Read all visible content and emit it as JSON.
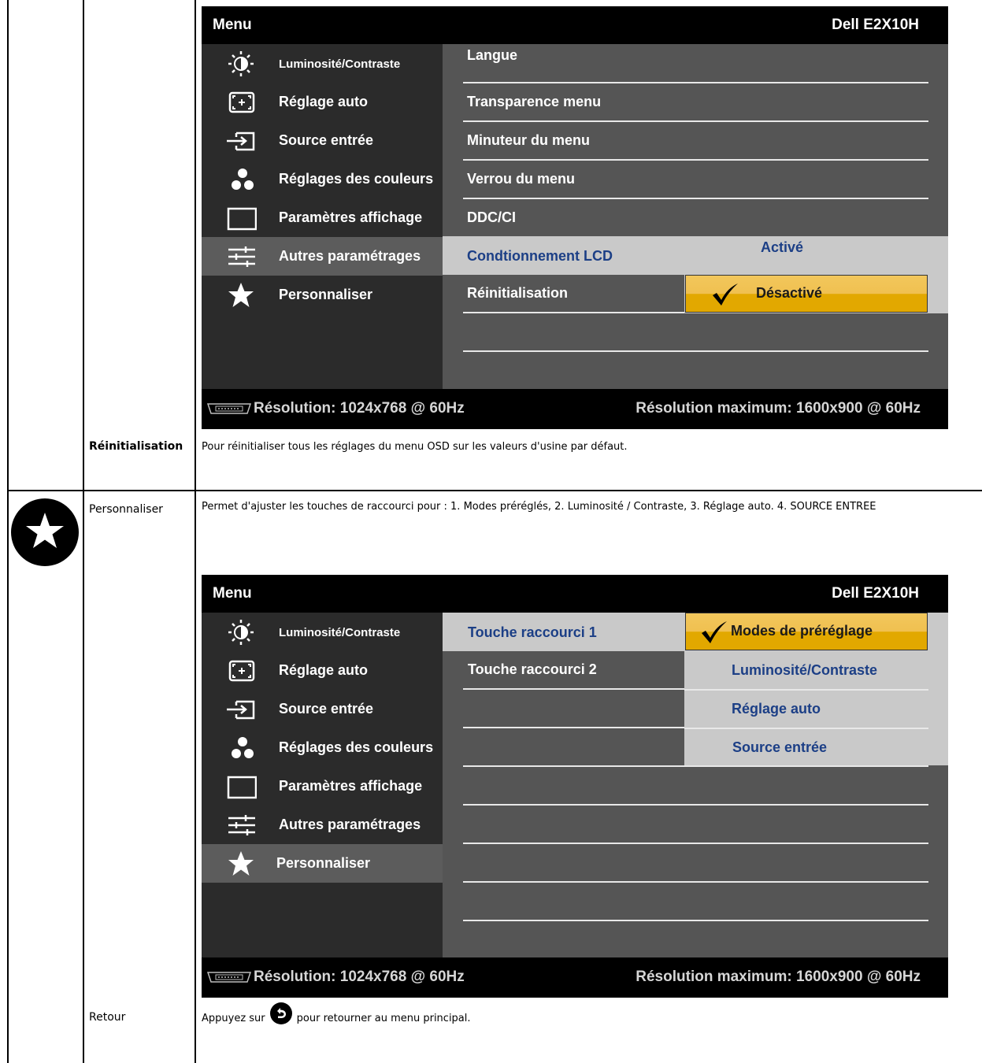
{
  "rows": {
    "reset": {
      "label": "Réinitialisation",
      "description": "Pour réinitialiser tous les réglages du menu OSD sur les valeurs d'usine par défaut."
    },
    "personalize": {
      "label": "Personnaliser",
      "description": "Permet d'ajuster les touches de raccourci pour : 1. Modes préréglés, 2. Luminosité / Contraste, 3. Réglage auto. 4. SOURCE ENTRÉE"
    },
    "back": {
      "label": "Retour",
      "description_before": "Appuyez sur",
      "description_after": "pour retourner au menu principal."
    }
  },
  "osd": {
    "title": "Menu",
    "model": "Dell E2X10H",
    "resolution": "Résolution: 1024x768 @ 60Hz",
    "max_resolution": "Résolution maximum: 1600x900 @ 60Hz",
    "menu_items": [
      {
        "label": "Luminosité/Contraste",
        "icon": "brightness-icon"
      },
      {
        "label": "Réglage auto",
        "icon": "auto-adjust-icon"
      },
      {
        "label": "Source entrée",
        "icon": "input-source-icon"
      },
      {
        "label": "Réglages des couleurs",
        "icon": "color-settings-icon"
      },
      {
        "label": "Paramètres affichage",
        "icon": "display-settings-icon"
      },
      {
        "label": "Autres paramétrages",
        "icon": "other-settings-icon"
      },
      {
        "label": "Personnaliser",
        "icon": "star-icon"
      }
    ]
  },
  "osd1": {
    "selected_menu": "Autres paramétrages",
    "submenu": [
      "Langue",
      "Transparence menu",
      "Minuteur du menu",
      "Verrou du menu",
      "DDC/CI",
      "Condtionnement LCD",
      "Réinitialisation"
    ],
    "highlighted_submenu": "Condtionnement LCD",
    "options": [
      "Activé",
      "Désactivé"
    ],
    "selected_option": "Désactivé"
  },
  "osd2": {
    "selected_menu": "Personnaliser",
    "submenu": [
      "Touche raccourci 1",
      "Touche raccourci 2"
    ],
    "highlighted_submenu": "Touche raccourci 1",
    "options": [
      "Modes de préréglage",
      "Luminosité/Contraste",
      "Réglage auto",
      "Source entrée"
    ],
    "selected_option": "Modes de préréglage"
  },
  "colors": {
    "osd_background": "#555555",
    "osd_left_panel": "#2b2b2b",
    "highlight_gray": "#c9c9c9",
    "highlight_yellow": "#e2a800",
    "option_text_blue": "#1c3f86"
  }
}
